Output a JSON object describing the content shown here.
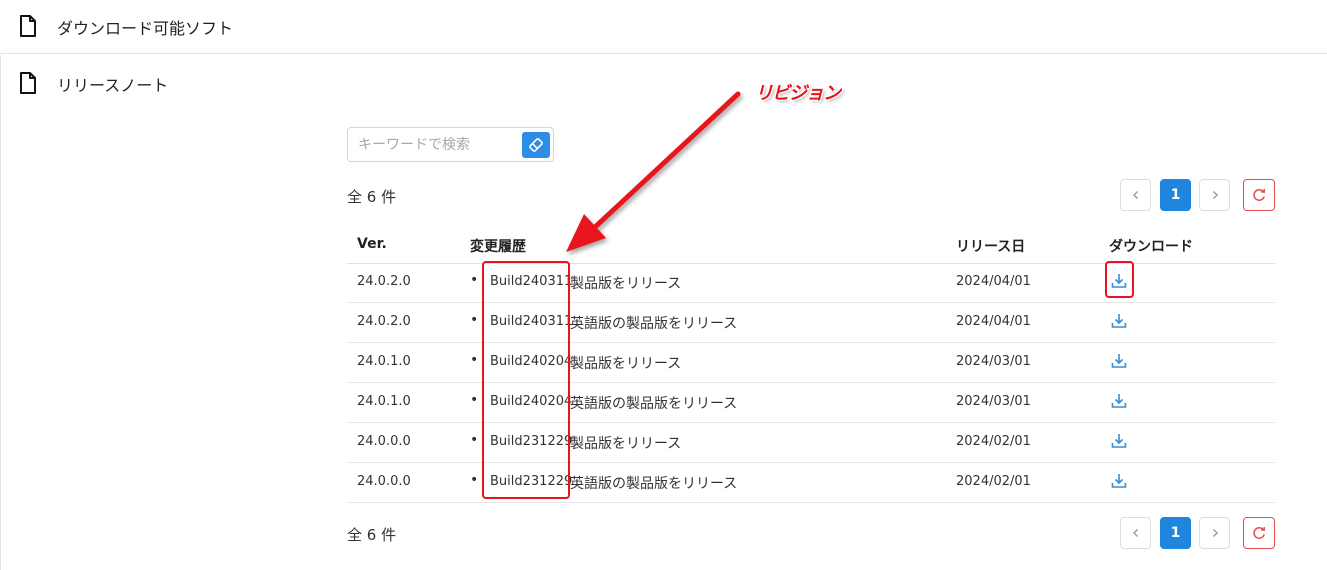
{
  "nav": {
    "download_software": "ダウンロード可能ソフト",
    "release_notes": "リリースノート"
  },
  "search": {
    "placeholder": "キーワードで検索",
    "clear_icon": "eraser-icon"
  },
  "count_label": "全 6 件",
  "pagination": {
    "current_page": "1",
    "prev_icon": "chevron-left-icon",
    "next_icon": "chevron-right-icon",
    "reload_icon": "reload-icon"
  },
  "table": {
    "headers": {
      "version": "Ver.",
      "history": "変更履歴",
      "release_date": "リリース日",
      "download": "ダウンロード"
    },
    "rows": [
      {
        "version": "24.0.2.0",
        "build": "Build240311",
        "desc": "製品版をリリース",
        "date": "2024/04/01"
      },
      {
        "version": "24.0.2.0",
        "build": "Build240311",
        "desc": "英語版の製品版をリリース",
        "date": "2024/04/01"
      },
      {
        "version": "24.0.1.0",
        "build": "Build240204",
        "desc": "製品版をリリース",
        "date": "2024/03/01"
      },
      {
        "version": "24.0.1.0",
        "build": "Build240204",
        "desc": "英語版の製品版をリリース",
        "date": "2024/03/01"
      },
      {
        "version": "24.0.0.0",
        "build": "Build231229",
        "desc": "製品版をリリース",
        "date": "2024/02/01"
      },
      {
        "version": "24.0.0.0",
        "build": "Build231229",
        "desc": "英語版の製品版をリリース",
        "date": "2024/02/01"
      }
    ]
  },
  "annotation": {
    "label": "リビジョン",
    "color": "#e8141c"
  },
  "colors": {
    "accent": "#1f86dd",
    "download_icon": "#3a8fd6",
    "reload_border": "#e24d4d"
  }
}
